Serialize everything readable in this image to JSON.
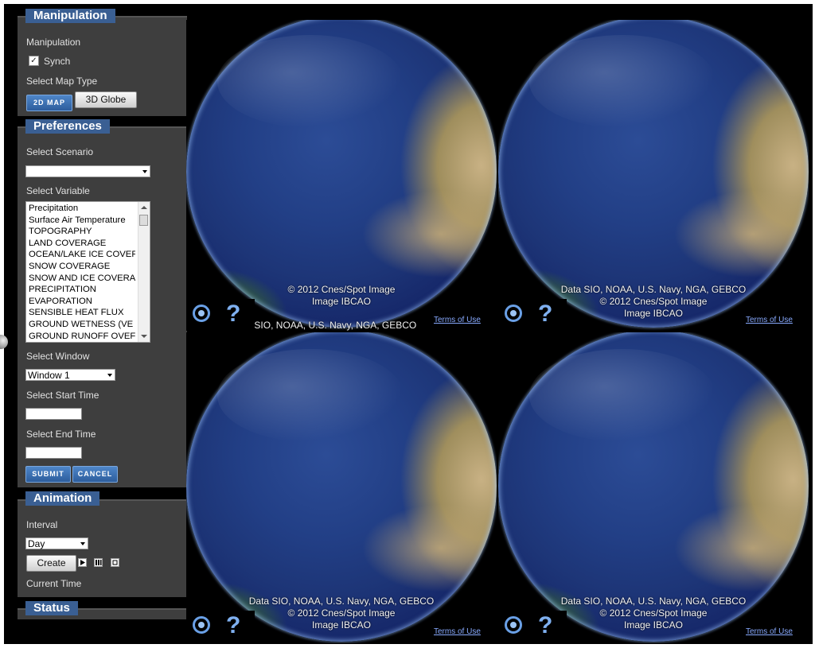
{
  "manipulation": {
    "section_title": "Manipulation",
    "label": "Manipulation",
    "synch_label": "Synch",
    "synch_checked": true,
    "map_type_label": "Select Map Type",
    "btn_2d": "2D MAP",
    "btn_3d": "3D Globe"
  },
  "preferences": {
    "section_title": "Preferences",
    "scenario_label": "Select Scenario",
    "scenario_value": "",
    "variable_label": "Select Variable",
    "variables": [
      "Precipitation",
      "Surface Air Temperature",
      "TOPOGRAPHY",
      "LAND COVERAGE",
      "OCEAN/LAKE ICE COVER",
      "SNOW COVERAGE",
      "SNOW AND ICE COVERA",
      "PRECIPITATION",
      "EVAPORATION",
      "SENSIBLE HEAT FLUX",
      "GROUND WETNESS (VE",
      "GROUND RUNOFF OVEF"
    ],
    "window_label": "Select Window",
    "window_value": "Window 1",
    "start_label": "Select Start Time",
    "end_label": "Select End Time",
    "submit": "SUBMIT",
    "cancel": "CANCEL"
  },
  "animation": {
    "section_title": "Animation",
    "interval_label": "Interval",
    "interval_value": "Day",
    "create": "Create",
    "current_time_label": "Current Time"
  },
  "status": {
    "section_title": "Status"
  },
  "maps": {
    "top_left": {
      "credits": [
        "© 2012 Cnes/Spot Image",
        "Image IBCAO",
        "Data SIO, NOAA, U.S. Navy, NGA, GEBCO"
      ],
      "terms": "Terms of Use"
    },
    "top_right": {
      "credits": [
        "Data SIO, NOAA, U.S. Navy, NGA, GEBCO",
        "© 2012 Cnes/Spot Image",
        "Image IBCAO"
      ],
      "terms": "Terms of Use"
    },
    "bottom_left": {
      "credits": [
        "Data SIO, NOAA, U.S. Navy, NGA, GEBCO",
        "© 2012 Cnes/Spot Image",
        "Image IBCAO"
      ],
      "terms": "Terms of Use"
    },
    "bottom_right": {
      "credits": [
        "Data SIO, NOAA, U.S. Navy, NGA, GEBCO",
        "© 2012 Cnes/Spot Image",
        "Image IBCAO"
      ],
      "terms": "Terms of Use"
    }
  },
  "colors": {
    "panel_bg": "#3e3e3e",
    "section_tab": "#3a5f93",
    "ocean": "#223f86",
    "accent_button": "#2d5d9c"
  }
}
